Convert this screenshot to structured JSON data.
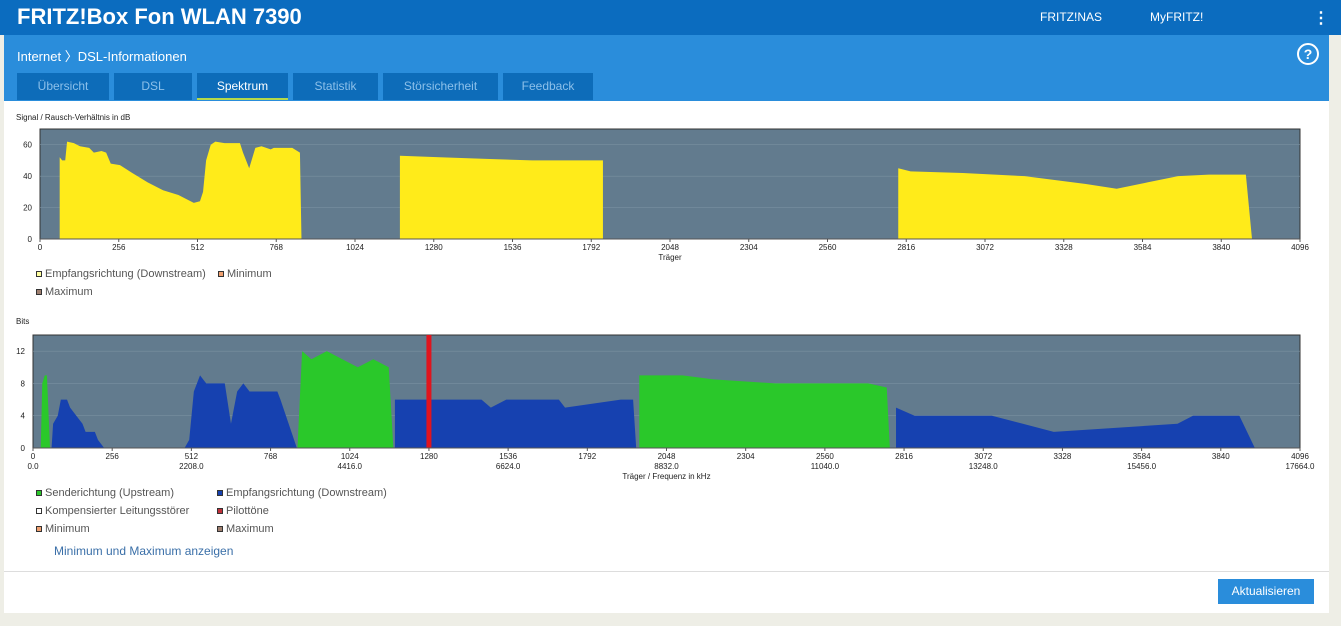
{
  "header": {
    "title": "FRITZ!Box Fon WLAN 7390",
    "links": [
      "FRITZ!NAS",
      "MyFRITZ!"
    ],
    "menu_icon": "⋮"
  },
  "breadcrumb": {
    "parent": "Internet",
    "separator": "〉",
    "current": "DSL-Informationen",
    "help": "?"
  },
  "tabs": [
    {
      "label": "Übersicht"
    },
    {
      "label": "DSL"
    },
    {
      "label": "Spektrum",
      "active": true
    },
    {
      "label": "Statistik"
    },
    {
      "label": "Störsicherheit"
    },
    {
      "label": "Feedback"
    }
  ],
  "colors": {
    "snr": "#ffeb1a",
    "upstream": "#2ac82a",
    "downstream": "#1641b0",
    "pilot": "#e0141e",
    "plot_bg": "#627b8e"
  },
  "chart_data": [
    {
      "type": "area",
      "title": "Signal / Rausch-Verhältnis in dB",
      "xlabel": "Träger",
      "xlim": [
        0,
        4096
      ],
      "ylim": [
        0,
        70
      ],
      "xticks": [
        0,
        256,
        512,
        768,
        1024,
        1280,
        1536,
        1792,
        2048,
        2304,
        2560,
        2816,
        3072,
        3328,
        3584,
        3840,
        4096
      ],
      "yticks": [
        0,
        20,
        40,
        60
      ],
      "series": [
        {
          "name": "Empfangsrichtung (Downstream)",
          "color": "#ffeb1a",
          "segments": [
            [
              [
                64,
                0
              ],
              [
                64,
                52
              ],
              [
                72,
                50
              ],
              [
                82,
                50
              ],
              [
                88,
                62
              ],
              [
                110,
                61
              ],
              [
                130,
                59
              ],
              [
                160,
                58
              ],
              [
                175,
                55
              ],
              [
                200,
                56
              ],
              [
                215,
                55
              ],
              [
                230,
                48
              ],
              [
                260,
                47
              ],
              [
                300,
                42
              ],
              [
                350,
                36
              ],
              [
                400,
                31
              ],
              [
                450,
                28
              ],
              [
                480,
                25
              ],
              [
                500,
                23
              ],
              [
                520,
                24
              ],
              [
                530,
                30
              ],
              [
                540,
                50
              ],
              [
                555,
                60
              ],
              [
                570,
                62
              ],
              [
                600,
                61
              ],
              [
                650,
                61
              ],
              [
                660,
                55
              ],
              [
                680,
                45
              ],
              [
                700,
                58
              ],
              [
                720,
                59
              ],
              [
                750,
                57
              ],
              [
                760,
                58
              ],
              [
                820,
                58
              ],
              [
                845,
                55
              ],
              [
                850,
                0
              ]
            ],
            [
              [
                1170,
                0
              ],
              [
                1170,
                53
              ],
              [
                1300,
                52
              ],
              [
                1450,
                51
              ],
              [
                1600,
                50
              ],
              [
                1830,
                50
              ],
              [
                1830,
                0
              ]
            ],
            [
              [
                2790,
                0
              ],
              [
                2790,
                45
              ],
              [
                2830,
                43
              ],
              [
                3000,
                42
              ],
              [
                3200,
                40
              ],
              [
                3400,
                35
              ],
              [
                3500,
                32
              ],
              [
                3600,
                36
              ],
              [
                3700,
                40
              ],
              [
                3800,
                41
              ],
              [
                3920,
                41
              ],
              [
                3940,
                0
              ]
            ]
          ]
        }
      ],
      "legend": [
        "Empfangsrichtung (Downstream)",
        "Minimum",
        "Maximum"
      ]
    },
    {
      "type": "area",
      "title": "Bits",
      "xlabel": "Träger / Frequenz in kHz",
      "xlim": [
        0,
        4096
      ],
      "ylim": [
        0,
        14
      ],
      "xticks": [
        0,
        256,
        512,
        768,
        1024,
        1280,
        1536,
        1792,
        2048,
        2304,
        2560,
        2816,
        3072,
        3328,
        3584,
        3840,
        4096
      ],
      "xticks_khz": [
        "0.0",
        "2208.0",
        "4416.0",
        "6624.0",
        "8832.0",
        "11040.0",
        "13248.0",
        "15456.0",
        "17664.0"
      ],
      "yticks": [
        0,
        4,
        8,
        12
      ],
      "series": [
        {
          "name": "Senderichtung (Upstream)",
          "color": "#2ac82a",
          "segments": [
            [
              [
                25,
                0
              ],
              [
                30,
                8
              ],
              [
                38,
                9
              ],
              [
                45,
                9
              ],
              [
                55,
                0
              ]
            ],
            [
              [
                855,
                0
              ],
              [
                870,
                12
              ],
              [
                900,
                11
              ],
              [
                950,
                12
              ],
              [
                1000,
                11
              ],
              [
                1050,
                10
              ],
              [
                1100,
                11
              ],
              [
                1150,
                10
              ],
              [
                1165,
                0
              ]
            ],
            [
              [
                1960,
                0
              ],
              [
                1960,
                9
              ],
              [
                2100,
                9
              ],
              [
                2200,
                8.5
              ],
              [
                2400,
                8
              ],
              [
                2700,
                8
              ],
              [
                2760,
                7.5
              ],
              [
                2770,
                0
              ]
            ]
          ]
        },
        {
          "name": "Empfangsrichtung (Downstream)",
          "color": "#1641b0",
          "segments": [
            [
              [
                60,
                0
              ],
              [
                65,
                3
              ],
              [
                80,
                4
              ],
              [
                90,
                6
              ],
              [
                110,
                6
              ],
              [
                120,
                5
              ],
              [
                140,
                4
              ],
              [
                160,
                3
              ],
              [
                170,
                2
              ],
              [
                200,
                2
              ],
              [
                210,
                1
              ],
              [
                230,
                0
              ]
            ],
            [
              [
                490,
                0
              ],
              [
                505,
                1
              ],
              [
                520,
                7
              ],
              [
                540,
                9
              ],
              [
                560,
                8
              ],
              [
                620,
                8
              ],
              [
                640,
                3
              ],
              [
                660,
                7
              ],
              [
                680,
                8
              ],
              [
                700,
                7
              ],
              [
                750,
                7
              ],
              [
                790,
                7
              ],
              [
                800,
                6
              ],
              [
                853,
                0
              ]
            ],
            [
              [
                1170,
                0
              ],
              [
                1170,
                6
              ],
              [
                1450,
                6
              ],
              [
                1480,
                5
              ],
              [
                1530,
                6
              ],
              [
                1700,
                6
              ],
              [
                1720,
                5
              ],
              [
                1900,
                6
              ],
              [
                1940,
                6
              ],
              [
                1950,
                0
              ]
            ],
            [
              [
                2790,
                0
              ],
              [
                2790,
                5
              ],
              [
                2850,
                4
              ],
              [
                3100,
                4
              ],
              [
                3200,
                3
              ],
              [
                3300,
                2
              ],
              [
                3700,
                3
              ],
              [
                3750,
                4
              ],
              [
                3900,
                4
              ],
              [
                3950,
                0
              ]
            ]
          ]
        },
        {
          "name": "Pilottöne",
          "color": "#e0141e",
          "carrier": 1280
        }
      ],
      "legend": [
        [
          "Senderichtung (Upstream)",
          "#2ac82a"
        ],
        [
          "Empfangsrichtung (Downstream)",
          "#1641b0"
        ],
        [
          "Kompensierter Leitungsstörer",
          "#ffffff"
        ],
        [
          "Pilottöne",
          "#c0303a"
        ],
        [
          "Minimum",
          "#f0a070"
        ],
        [
          "Maximum",
          "#a08070"
        ]
      ]
    }
  ],
  "legend1": {
    "a": "Empfangsrichtung (Downstream)",
    "b": "Minimum",
    "c": "Maximum"
  },
  "legend2": {
    "a": "Senderichtung (Upstream)",
    "b": "Empfangsrichtung (Downstream)",
    "c": "Kompensierter Leitungsstörer",
    "d": "Pilottöne",
    "e": "Minimum",
    "f": "Maximum"
  },
  "show_minmax": "Minimum und Maximum anzeigen",
  "refresh": "Aktualisieren"
}
